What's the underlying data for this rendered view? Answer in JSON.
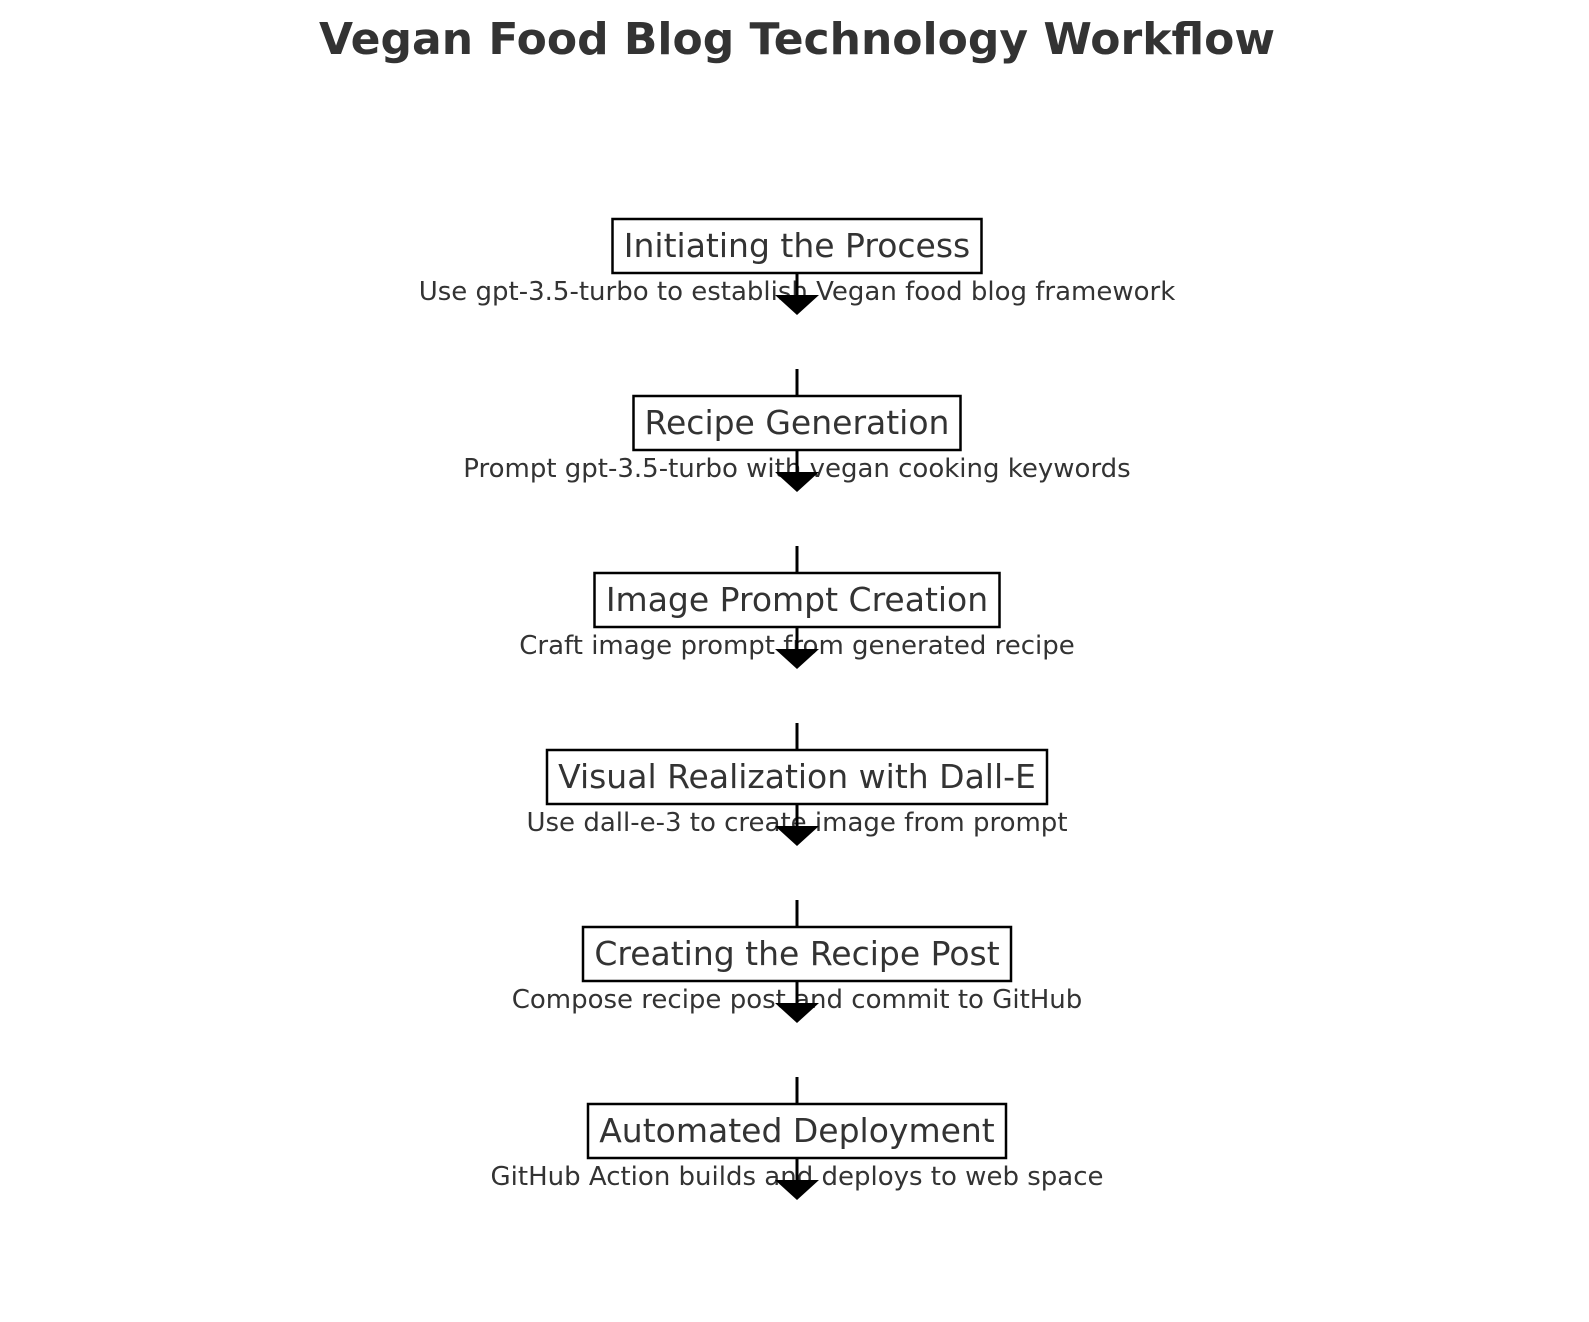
{
  "title": "Vegan Food Blog Technology Workflow",
  "steps": [
    {
      "title": "Initiating the Process",
      "description": "Use gpt-3.5-turbo to establish Vegan food blog framework"
    },
    {
      "title": "Recipe Generation",
      "description": "Prompt gpt-3.5-turbo with vegan cooking keywords"
    },
    {
      "title": "Image Prompt Creation",
      "description": "Craft image prompt from generated recipe"
    },
    {
      "title": "Visual Realization with Dall-E",
      "description": "Use dall-e-3 to create image from prompt"
    },
    {
      "title": "Creating the Recipe Post",
      "description": "Compose recipe post and commit to GitHub"
    },
    {
      "title": "Automated Deployment",
      "description": "GitHub Action builds and deploys to web space"
    }
  ]
}
